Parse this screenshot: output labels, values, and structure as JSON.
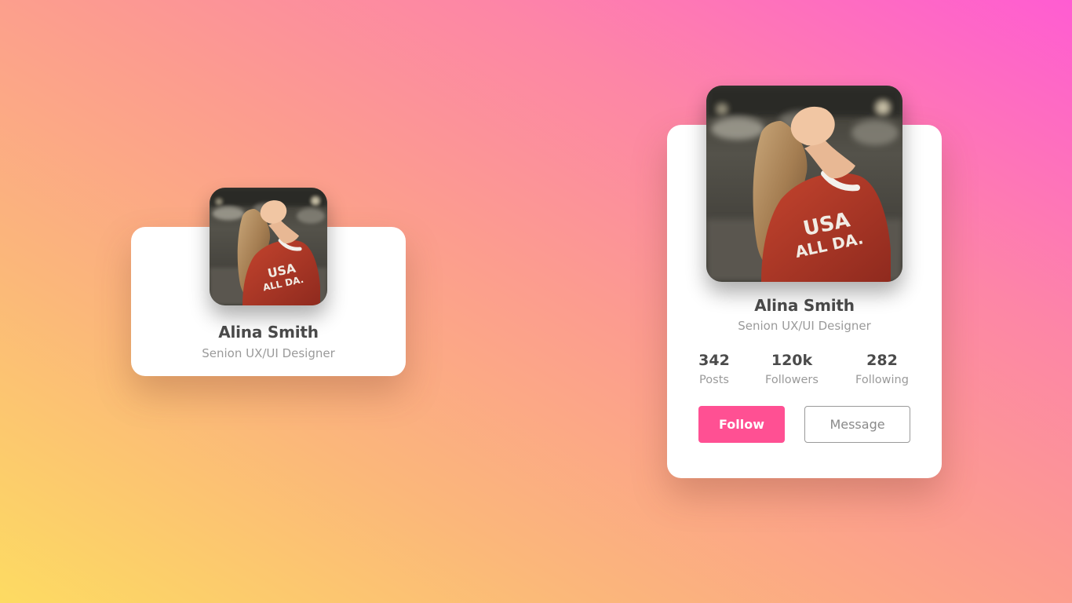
{
  "cards": {
    "small": {
      "name": "Alina Smith",
      "role": "Senion UX/UI Designer"
    },
    "large": {
      "name": "Alina Smith",
      "role": "Senion UX/UI Designer",
      "stats": [
        {
          "value": "342",
          "label": "Posts"
        },
        {
          "value": "120k",
          "label": "Followers"
        },
        {
          "value": "282",
          "label": "Following"
        }
      ],
      "follow_label": "Follow",
      "message_label": "Message"
    }
  },
  "colors": {
    "accent": "#ff5093",
    "background_start": "#fddb62",
    "background_end": "#ff5cd2"
  }
}
